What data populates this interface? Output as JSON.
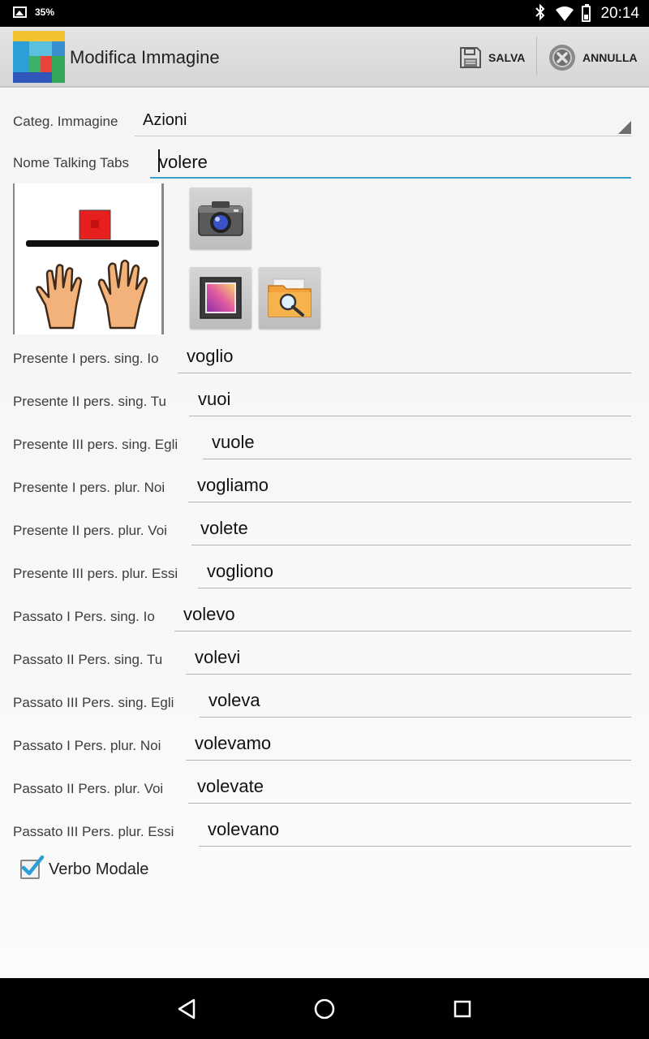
{
  "status_bar": {
    "battery_percent": "35%",
    "time": "20:14",
    "icons": [
      "image-notification-icon",
      "bluetooth-icon",
      "wifi-icon",
      "battery-icon"
    ]
  },
  "action_bar": {
    "title": "Modifica Immagine",
    "save_label": "SALVA",
    "cancel_label": "ANNULLA"
  },
  "form": {
    "category": {
      "label": "Categ. Immagine",
      "value": "Azioni"
    },
    "name": {
      "label": "Nome Talking Tabs",
      "value": "volere"
    },
    "image_buttons": [
      "camera-icon",
      "gallery-icon",
      "folder-search-icon"
    ],
    "conjugations": [
      {
        "label": "Presente I pers. sing. Io",
        "value": "voglio"
      },
      {
        "label": "Presente II pers. sing. Tu",
        "value": "vuoi"
      },
      {
        "label": "Presente III pers. sing. Egli",
        "value": "vuole"
      },
      {
        "label": "Presente I pers. plur. Noi",
        "value": "vogliamo"
      },
      {
        "label": "Presente II pers. plur. Voi",
        "value": "volete"
      },
      {
        "label": "Presente III pers. plur. Essi",
        "value": "vogliono"
      },
      {
        "label": "Passato I Pers. sing. Io",
        "value": "volevo"
      },
      {
        "label": "Passato II Pers. sing. Tu",
        "value": "volevi"
      },
      {
        "label": "Passato III Pers. sing. Egli",
        "value": "voleva"
      },
      {
        "label": "Passato I Pers. plur. Noi",
        "value": "volevamo"
      },
      {
        "label": "Passato II Pers. plur. Voi",
        "value": "volevate"
      },
      {
        "label": "Passato III Pers. plur. Essi",
        "value": "volevano"
      }
    ],
    "modal_verb": {
      "label": "Verbo Modale",
      "checked": true
    }
  },
  "colors": {
    "accent": "#3aa0c8",
    "checkmark": "#2a9fd6",
    "action_bar": "#dcdcdc"
  }
}
